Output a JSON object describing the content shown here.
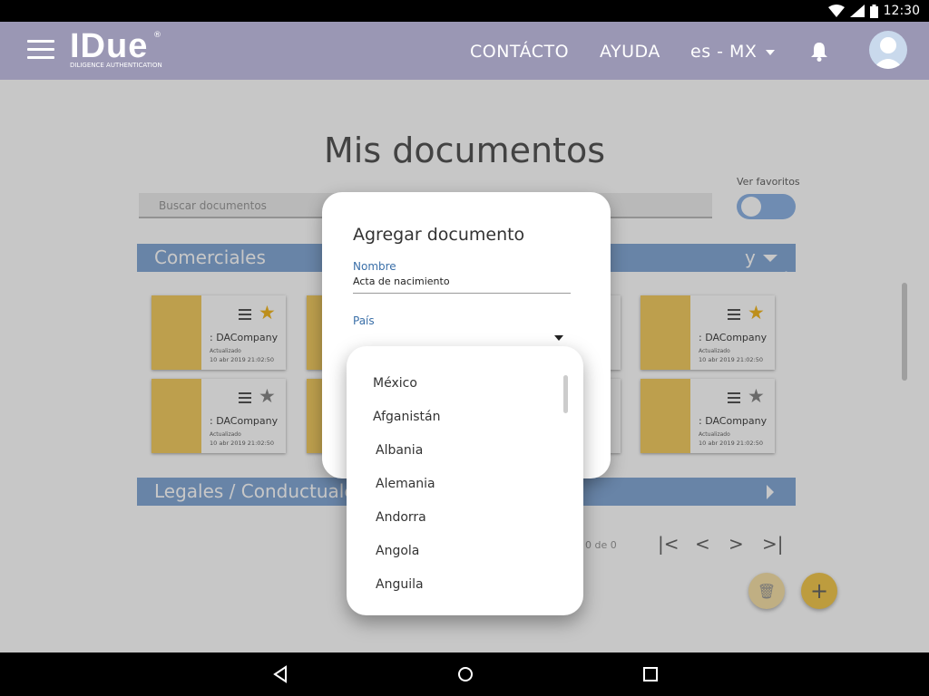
{
  "status": {
    "time": "12:30"
  },
  "app_bar": {
    "logo": "IDue",
    "logo_reg": "®",
    "logo_sub": "DILIGENCE AUTHENTICATION",
    "contact": "CONTÁCTO",
    "help": "AYUDA",
    "locale": "es - MX"
  },
  "page": {
    "title": "Mis documentos",
    "search_placeholder": "Buscar documentos",
    "favorites_label": "Ver favoritos",
    "section_commercial": "Comerciales",
    "section_commercial_right": "y servicios",
    "section_legal": "Legales / Conductuales",
    "pager_text": "0 de 0"
  },
  "cards": {
    "name": ": DACompany",
    "updated": "Actualizado",
    "date": "10 abr 2019 21:02:50"
  },
  "dialog": {
    "title": "Agregar documento",
    "name_label": "Nombre",
    "name_value": "Acta de nacimiento",
    "country_label": "País"
  },
  "dropdown": {
    "options": [
      "México",
      "Afganistán",
      "Albania",
      "Alemania",
      "Andorra",
      "Angola",
      "Anguila"
    ]
  },
  "colors": {
    "app_bar": "#9a97b4",
    "section": "#86a9d6",
    "card_thumb": "#f2cc63",
    "star": "#f2b824",
    "label": "#3a6fa8"
  }
}
